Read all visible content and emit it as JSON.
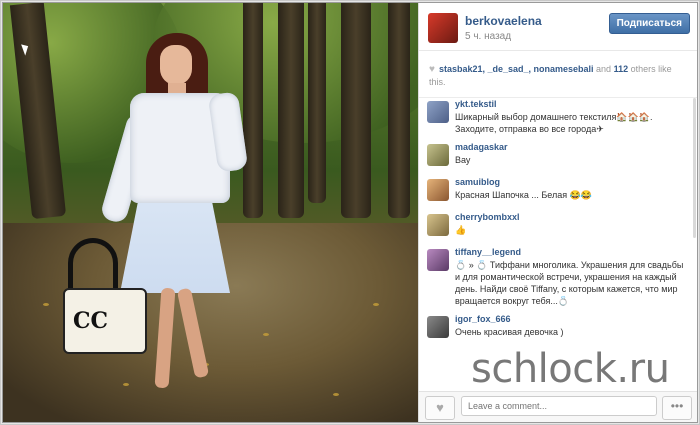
{
  "post": {
    "owner": "berkovaelena",
    "time": "5 ч. назад",
    "follow_label": "Подписаться",
    "photo_logo": "CC"
  },
  "likes": {
    "users": "stasbak21, _de_sad_, nonamesebali",
    "and_text": "and",
    "count": "112",
    "tail": "others like this."
  },
  "comments": [
    {
      "user": "ykt.tekstil",
      "text": "Шикарный выбор домашнего текстиля🏠🏠🏠. Заходите, отправка во все города✈"
    },
    {
      "user": "madagaskar",
      "text": "Вау"
    },
    {
      "user": "samuiblog",
      "text": "Красная Шапочка ... Белая 😂😂"
    },
    {
      "user": "cherrybombxxl",
      "text": "👍"
    },
    {
      "user": "tiffany__legend",
      "text": "💍 » 💍 Тиффани многолика. Украшения для свадьбы и для романтической встречи, украшения на каждый день. Найди своё Tiffany, с которым кажется, что мир вращается вокруг тебя...💍"
    },
    {
      "user": "igor_fox_666",
      "text": "Очень красивая девочка )"
    }
  ],
  "footer": {
    "comment_placeholder": "Leave a comment...",
    "more_label": "•••",
    "like_icon": "heart-icon"
  },
  "watermark": "schlock.ru",
  "colors": {
    "link": "#355b8a",
    "follow_button": "#4a7ab4"
  }
}
